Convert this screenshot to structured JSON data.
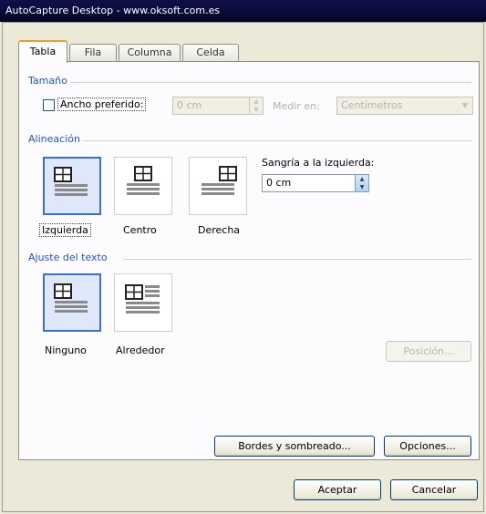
{
  "window": {
    "title": "AutoCapture Desktop - www.oksoft.com.es"
  },
  "tabs": [
    {
      "label": "Tabla",
      "active": true
    },
    {
      "label": "Fila",
      "active": false
    },
    {
      "label": "Columna",
      "active": false
    },
    {
      "label": "Celda",
      "active": false
    }
  ],
  "size": {
    "section": "Tamaño",
    "preferred_width_label": "Ancho preferido:",
    "preferred_width_checked": false,
    "width_value": "0 cm",
    "measure_label": "Medir en:",
    "measure_value": "Centímetros"
  },
  "alignment": {
    "section": "Alineación",
    "options": [
      {
        "label": "Izquierda",
        "selected": true,
        "icon": "align-left-icon"
      },
      {
        "label": "Centro",
        "selected": false,
        "icon": "align-center-icon"
      },
      {
        "label": "Derecha",
        "selected": false,
        "icon": "align-right-icon"
      }
    ],
    "indent_label": "Sangría a la izquierda:",
    "indent_value": "0 cm"
  },
  "wrapping": {
    "section": "Ajuste del texto",
    "options": [
      {
        "label": "Ninguno",
        "selected": true,
        "icon": "wrap-none-icon"
      },
      {
        "label": "Alrededor",
        "selected": false,
        "icon": "wrap-around-icon"
      }
    ],
    "position_button": "Posición..."
  },
  "buttons": {
    "borders": "Bordes y sombreado...",
    "options": "Opciones...",
    "ok": "Aceptar",
    "cancel": "Cancelar"
  },
  "colors": {
    "selected_border": "#3a6fd0",
    "section_text": "#2255bb",
    "titlebar": "#0a0a36"
  }
}
